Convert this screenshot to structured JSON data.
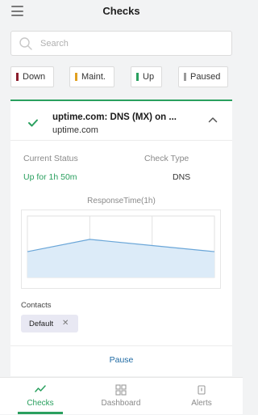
{
  "header": {
    "title": "Checks",
    "menu_icon": "hamburger-menu-icon"
  },
  "search": {
    "placeholder": "Search",
    "value": "",
    "icon": "search-icon"
  },
  "filters": [
    {
      "label": "Down",
      "color": "#8b1d2c"
    },
    {
      "label": "Maint.",
      "color": "#e0a020"
    },
    {
      "label": "Up",
      "color": "#2aa05f"
    },
    {
      "label": "Paused",
      "color": "#9a9a9a"
    }
  ],
  "check": {
    "name": "uptime.com: DNS (MX) on ...",
    "host": "uptime.com",
    "status_color": "#2aa05f",
    "current_status_label": "Current Status",
    "current_status_value": "Up for 1h 50m",
    "check_type_label": "Check Type",
    "check_type_value": "DNS",
    "response_time_title": "ResponseTime(1h)",
    "contacts_label": "Contacts",
    "contacts": [
      {
        "label": "Default",
        "remove_symbol": "✕"
      }
    ],
    "pause_label": "Pause"
  },
  "chart_data": {
    "type": "area",
    "title": "ResponseTime(1h)",
    "x": [
      0,
      1,
      2,
      3
    ],
    "series": [
      {
        "values": [
          0.42,
          0.62,
          0.52,
          0.42
        ]
      }
    ],
    "ylim": [
      0,
      1
    ],
    "grid": true,
    "color": "#6aa6d8"
  },
  "tabs": [
    {
      "label": "Checks",
      "icon": "activity-icon",
      "active": true
    },
    {
      "label": "Dashboard",
      "icon": "dashboard-grid-icon",
      "active": false
    },
    {
      "label": "Alerts",
      "icon": "alert-icon",
      "active": false
    }
  ]
}
